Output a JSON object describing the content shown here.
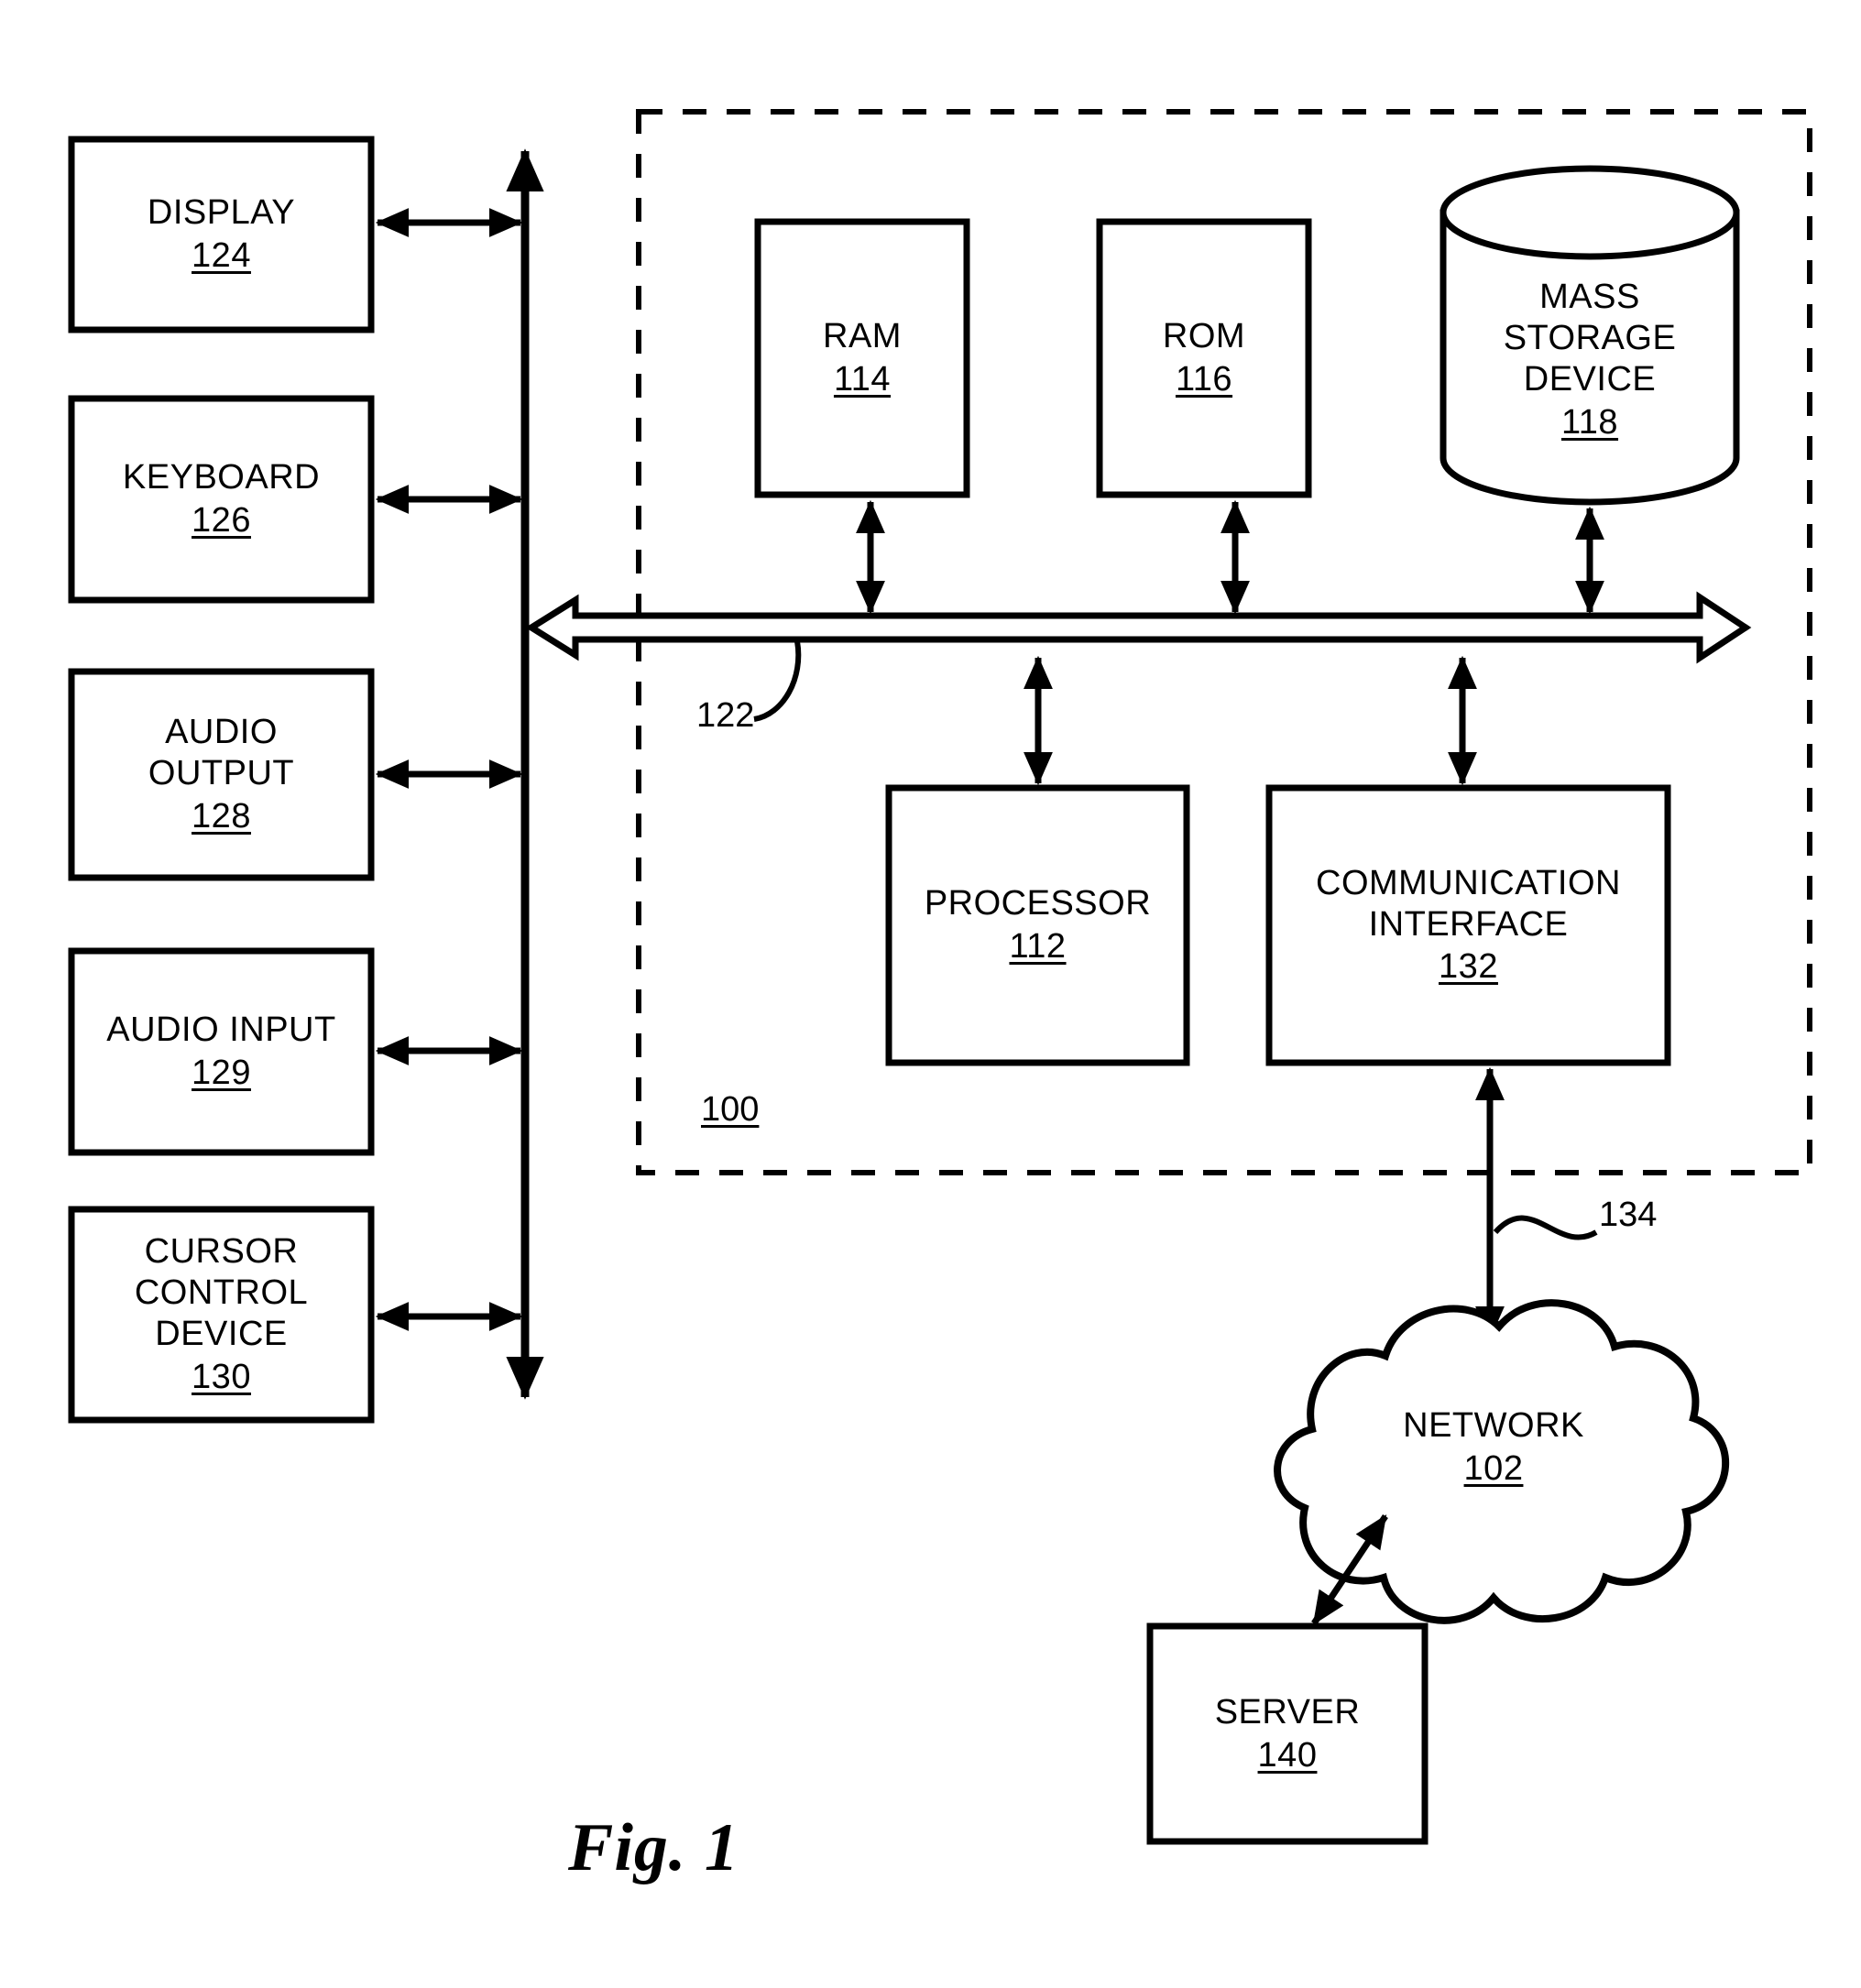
{
  "figure": {
    "caption": "Fig. 1",
    "system_ref": "100",
    "bus_ref": "122",
    "link_ref": "134"
  },
  "peripherals": [
    {
      "name": "display",
      "title": "DISPLAY",
      "ref": "124"
    },
    {
      "name": "keyboard",
      "title": "KEYBOARD",
      "ref": "126"
    },
    {
      "name": "audio-output",
      "title": "AUDIO\nOUTPUT",
      "ref": "128"
    },
    {
      "name": "audio-input",
      "title": "AUDIO INPUT",
      "ref": "129"
    },
    {
      "name": "cursor-control",
      "title": "CURSOR\nCONTROL\nDEVICE",
      "ref": "130"
    }
  ],
  "peripheral_labels": {
    "display_title": "DISPLAY",
    "display_ref": "124",
    "keyboard_title": "KEYBOARD",
    "keyboard_ref": "126",
    "audio_output_line1": "AUDIO",
    "audio_output_line2": "OUTPUT",
    "audio_output_ref": "128",
    "audio_input_title": "AUDIO INPUT",
    "audio_input_ref": "129",
    "cursor_line1": "CURSOR",
    "cursor_line2": "CONTROL",
    "cursor_line3": "DEVICE",
    "cursor_ref": "130"
  },
  "system": {
    "ref": "100",
    "bus_ref": "122",
    "components": {
      "ram_title": "RAM",
      "ram_ref": "114",
      "rom_title": "ROM",
      "rom_ref": "116",
      "mass_storage_line1": "MASS",
      "mass_storage_line2": "STORAGE",
      "mass_storage_line3": "DEVICE",
      "mass_storage_ref": "118",
      "processor_title": "PROCESSOR",
      "processor_ref": "112",
      "comm_line1": "COMMUNICATION",
      "comm_line2": "INTERFACE",
      "comm_ref": "132"
    }
  },
  "external": {
    "network_title": "NETWORK",
    "network_ref": "102",
    "server_title": "SERVER",
    "server_ref": "140",
    "link_ref": "134"
  },
  "colors": {
    "line": "#000000",
    "background": "#ffffff"
  }
}
